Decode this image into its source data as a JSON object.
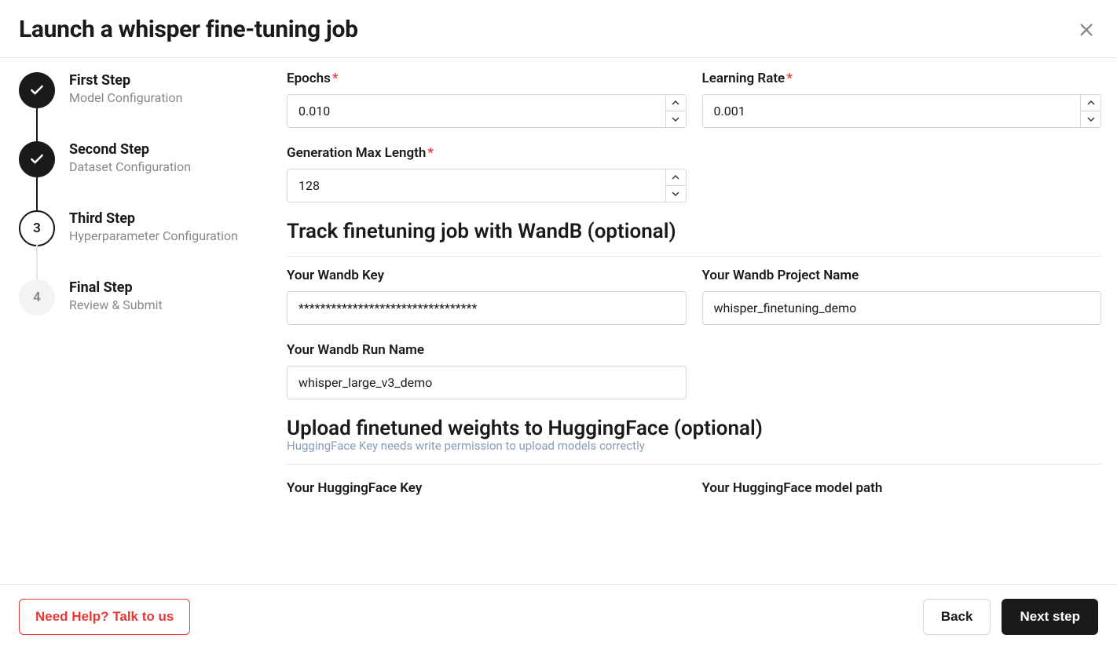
{
  "header": {
    "title": "Launch a whisper fine-tuning job"
  },
  "steps": [
    {
      "title": "First Step",
      "sub": "Model Configuration",
      "state": "done"
    },
    {
      "title": "Second Step",
      "sub": "Dataset Configuration",
      "state": "done"
    },
    {
      "title": "Third Step",
      "sub": "Hyperparameter Configuration",
      "state": "current",
      "num": "3"
    },
    {
      "title": "Final Step",
      "sub": "Review & Submit",
      "state": "pending",
      "num": "4"
    }
  ],
  "form": {
    "epochs": {
      "label": "Epochs",
      "value": "0.010",
      "required": true
    },
    "lr": {
      "label": "Learning Rate",
      "value": "0.001",
      "required": true
    },
    "gen_max_len": {
      "label": "Generation Max Length",
      "value": "128",
      "required": true
    },
    "wandb_section": "Track finetuning job with WandB (optional)",
    "wandb_key": {
      "label": "Your Wandb Key",
      "value": "*********************************"
    },
    "wandb_project": {
      "label": "Your Wandb Project Name",
      "value": "whisper_finetuning_demo"
    },
    "wandb_run": {
      "label": "Your Wandb Run Name",
      "value": "whisper_large_v3_demo"
    },
    "hf_section": "Upload finetuned weights to HuggingFace (optional)",
    "hf_note": "HuggingFace Key needs write permission to upload models correctly",
    "hf_key": {
      "label": "Your HuggingFace Key"
    },
    "hf_path": {
      "label": "Your HuggingFace model path"
    }
  },
  "footer": {
    "help": "Need Help? Talk to us",
    "back": "Back",
    "next": "Next step"
  }
}
